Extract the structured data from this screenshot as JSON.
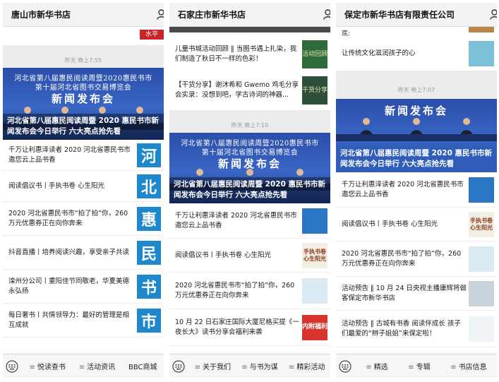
{
  "colors": {
    "accent": "#1d88cc",
    "banner_blue": "#3a66c6",
    "panel_bg": "#ececec"
  },
  "panels": [
    {
      "title": "唐山市新华书店",
      "top_badge": "水平",
      "time": "昨天 晚上7:55",
      "banner": {
        "line1": "河北省第八届惠民阅读周暨2020惠民书市",
        "line2": "第十届河北省图书交易博览会",
        "big": "新闻发布会",
        "caption": "河北省第八届惠民阅读周暨 2020 惠民书市新闻发布会今日举行 六大亮点抢先看"
      },
      "articles": [
        {
          "text": "千万让利惠泽读者 2020 河北省惠民书市邀您云上品书香",
          "thumb": "河"
        },
        {
          "text": "阅读倡议书丨手执书卷 心生阳光",
          "thumb": "北"
        },
        {
          "text": "2020 河北省惠民书市“拍了拍”你，260 万元优惠券正在向你奔来",
          "thumb": "惠"
        },
        {
          "text": "抖音直播丨培养阅读兴趣，享受亲子共读",
          "thumb": "民"
        },
        {
          "text": "滦州分公司丨重阳佳节同敬老，华夏美德永弘扬",
          "thumb": "书"
        },
        {
          "text": "每日奢书丨共情领导力：最好的管理是相互成就",
          "thumb": "市"
        }
      ],
      "menu": [
        "悦读查书",
        "活动资讯",
        "BBC商城"
      ]
    },
    {
      "title": "石家庄市新华书店",
      "top_articles": [
        {
          "text": "儿童书城活动回顾 ‖ 当图书遇上扎染，我们制造了秋日不一样的色彩！",
          "thumb": "活动回顾"
        },
        {
          "text": "【干货分享】谢沐希和 Gwemo 鸡毛分享会实录：没想到吧，学古诗词的神器...",
          "thumb": "干货分享"
        }
      ],
      "time": "昨天 晚上7:10",
      "banner": {
        "line1": "河北省第八届惠民阅读周暨2020惠民书市",
        "line2": "第十届河北省图书交易博览会",
        "big": "新闻发布会",
        "caption": "河北省第八届惠民阅读周暨 2020 惠民书市新闻发布会今日举行 六大亮点抢先看"
      },
      "articles": [
        {
          "text": "千万让利惠泽读者 2020 河北省惠民书市邀您云上品书香",
          "thumb": ""
        },
        {
          "text": "阅读倡议书丨手执书卷 心生阳光",
          "thumb": "手执书卷 心生阳光"
        },
        {
          "text": "2020 河北省惠民书市“拍了拍”你，260 万元优惠券正在向你奔来",
          "thumb": ""
        },
        {
          "text": "10 月 22 日石家庄国际大厦尼格买提《一夜长大》读书分享会福利来袭",
          "thumb": "内附福利"
        }
      ],
      "menu": [
        "关于我们",
        "与书为谋",
        "精彩活动"
      ]
    },
    {
      "title": "保定市新华书店有限责任公司",
      "top_fragment": "底:",
      "top_articles": [
        {
          "text": "让传统文化滋润孩子的心",
          "thumb": ""
        }
      ],
      "time": "昨天 晚上7:07",
      "banner": {
        "line1": "",
        "line2": "",
        "big": "新闻发布会",
        "caption": "河北省第八届惠民阅读周暨 2020 惠民书市新闻发布会今日举行 六大亮点抢先看"
      },
      "articles": [
        {
          "text": "千万让利惠泽读者 2020 河北省惠民书市邀您云上品书香",
          "thumb": ""
        },
        {
          "text": "阅读倡议书丨手执书卷 心生阳光",
          "thumb": "手执书卷 心生阳光"
        },
        {
          "text": "2020 河北省惠民书市“拍了拍”你，260 万元优惠券正在向你奔来",
          "thumb": ""
        },
        {
          "text": "活动预告 ‖ 10 月 24 日央视主播康辉将做客保定市新华书店",
          "thumb": ""
        },
        {
          "text": "活动预告 ‖ 古城有书香 阅读伴成长 孩子们最爱的“辫子姐姐”来保定啦！",
          "thumb": ""
        }
      ],
      "menu": [
        "精选",
        "专辑",
        "书店信息"
      ]
    }
  ]
}
